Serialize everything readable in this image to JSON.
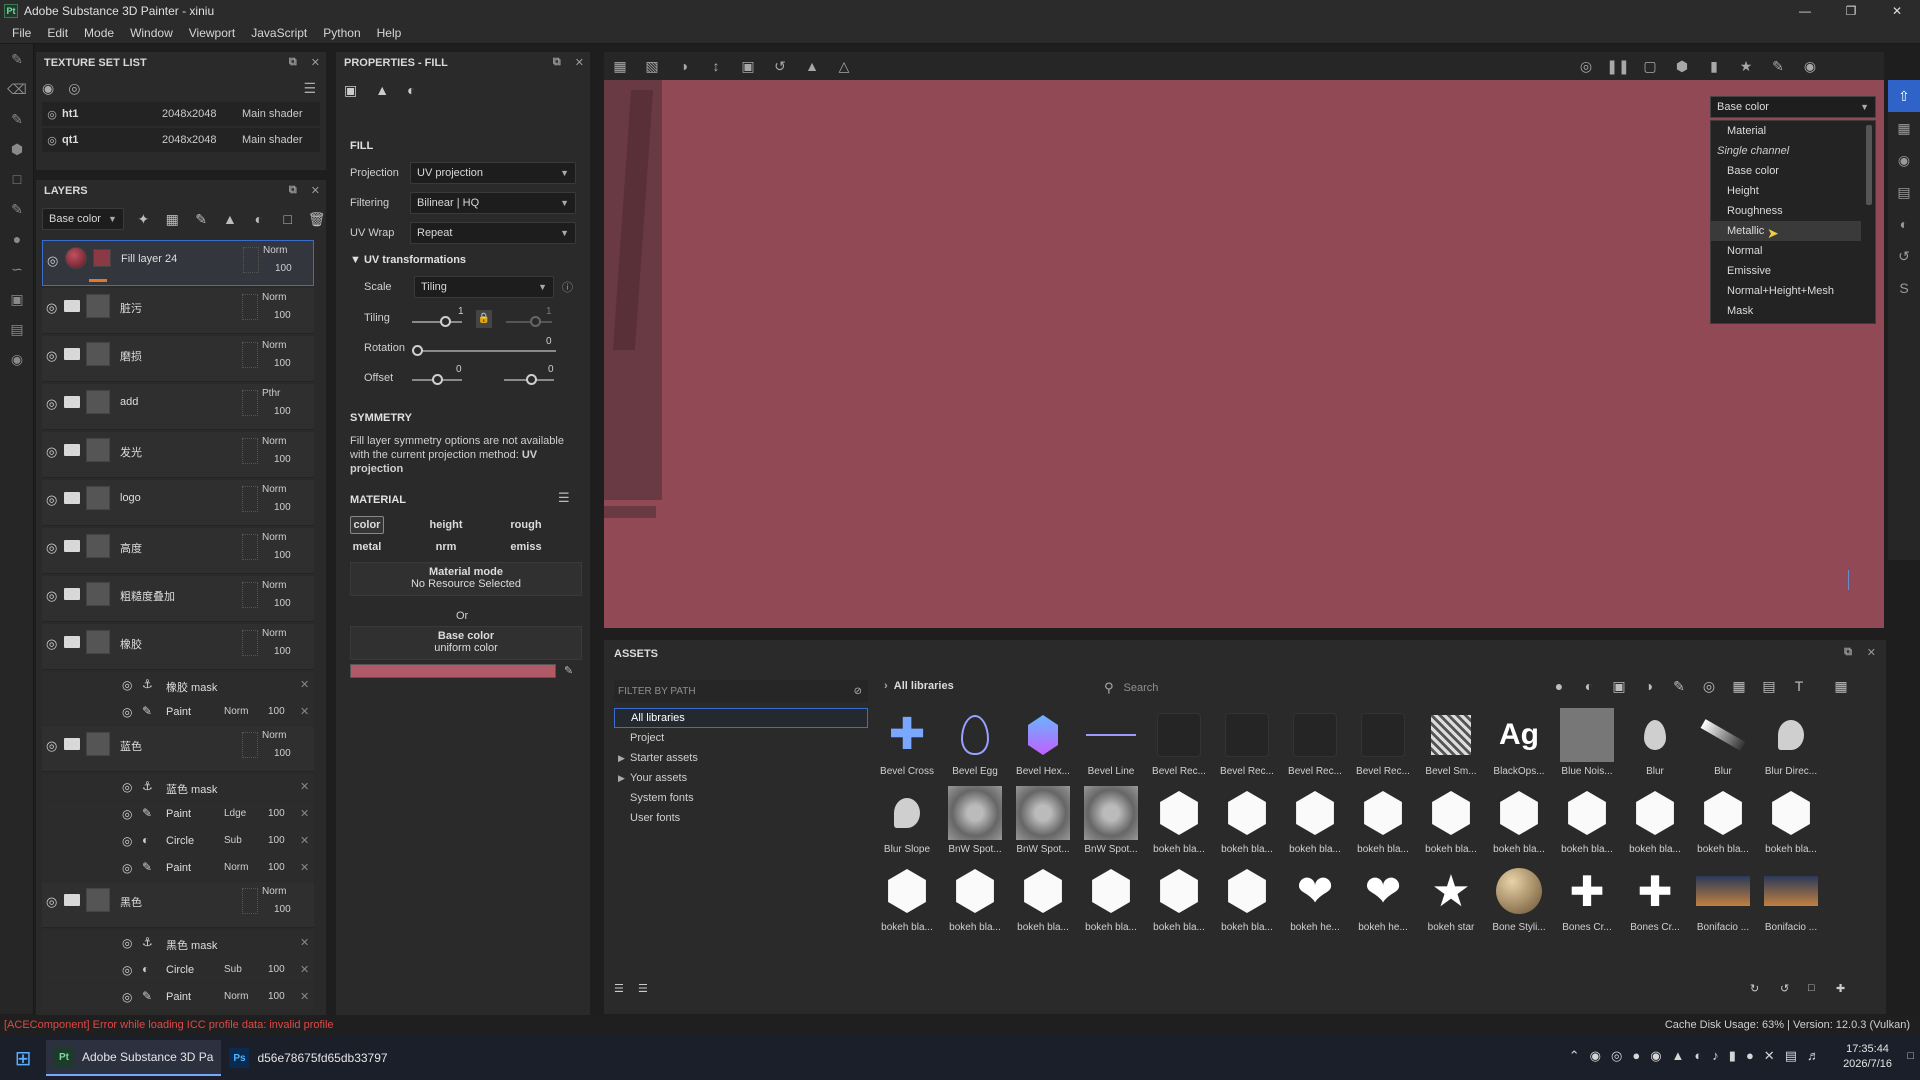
{
  "window": {
    "title": "Adobe Substance 3D Painter - xiniu",
    "logo": "Pt"
  },
  "menu": [
    "File",
    "Edit",
    "Mode",
    "Window",
    "Viewport",
    "JavaScript",
    "Python",
    "Help"
  ],
  "texture_set_list": {
    "title": "TEXTURE SET LIST",
    "rows": [
      {
        "name": "ht1",
        "res": "2048x2048",
        "shader": "Main shader"
      },
      {
        "name": "qt1",
        "res": "2048x2048",
        "shader": "Main shader"
      }
    ]
  },
  "layers": {
    "title": "LAYERS",
    "channel": "Base color",
    "items": [
      {
        "name": "Fill layer 24",
        "blend": "Norm",
        "opacity": "100",
        "type": "fill"
      },
      {
        "name": "脏污",
        "blend": "Norm",
        "opacity": "100",
        "type": "folder"
      },
      {
        "name": "磨损",
        "blend": "Norm",
        "opacity": "100",
        "type": "folder"
      },
      {
        "name": "add",
        "blend": "Pthr",
        "opacity": "100",
        "type": "folder"
      },
      {
        "name": "发光",
        "blend": "Norm",
        "opacity": "100",
        "type": "folder"
      },
      {
        "name": "logo",
        "blend": "Norm",
        "opacity": "100",
        "type": "folder"
      },
      {
        "name": "高度",
        "blend": "Norm",
        "opacity": "100",
        "type": "folder"
      },
      {
        "name": "粗糙度叠加",
        "blend": "Norm",
        "opacity": "100",
        "type": "folder"
      },
      {
        "name": "橡胶",
        "blend": "Norm",
        "opacity": "100",
        "type": "folder"
      },
      {
        "name": "蓝色",
        "blend": "Norm",
        "opacity": "100",
        "type": "folder"
      },
      {
        "name": "黑色",
        "blend": "Norm",
        "opacity": "100",
        "type": "folder"
      }
    ],
    "sub": [
      {
        "name": "橡胶 mask",
        "blend": "",
        "opacity": ""
      },
      {
        "name": "Paint",
        "blend": "Norm",
        "opacity": "100"
      },
      {
        "name": "蓝色 mask",
        "blend": "",
        "opacity": ""
      },
      {
        "name": "Paint",
        "blend": "Ldge",
        "opacity": "100"
      },
      {
        "name": "Circle",
        "blend": "Sub",
        "opacity": "100"
      },
      {
        "name": "Paint",
        "blend": "Norm",
        "opacity": "100"
      },
      {
        "name": "黑色 mask",
        "blend": "",
        "opacity": ""
      },
      {
        "name": "Circle",
        "blend": "Sub",
        "opacity": "100"
      },
      {
        "name": "Paint",
        "blend": "Norm",
        "opacity": "100"
      }
    ]
  },
  "properties": {
    "title": "PROPERTIES - FILL",
    "fill": "FILL",
    "projection_label": "Projection",
    "projection": "UV projection",
    "filtering_label": "Filtering",
    "filtering": "Bilinear | HQ",
    "uvwrap_label": "UV Wrap",
    "uvwrap": "Repeat",
    "uv_trans": "UV transformations",
    "scale_label": "Scale",
    "scale": "Tiling",
    "tiling_label": "Tiling",
    "tiling_val": "1",
    "tiling_val2": "1",
    "rotation_label": "Rotation",
    "rotation_val": "0",
    "offset_label": "Offset",
    "offset_val1": "0",
    "offset_val2": "0",
    "symmetry": "SYMMETRY",
    "sym_text": "Fill layer symmetry options are not available with the current projection method:",
    "sym_bold": "UV projection",
    "material": "MATERIAL",
    "chips": [
      "color",
      "height",
      "rough",
      "metal",
      "nrm",
      "emiss"
    ],
    "mat_mode": "Material mode",
    "no_res": "No Resource Selected",
    "or": "Or",
    "base_color": "Base color",
    "uniform": "uniform color",
    "swatch": "#b05a67"
  },
  "viewport": {
    "color": "#914956",
    "channel": "Base color",
    "menu": [
      {
        "label": "Material",
        "type": "item"
      },
      {
        "label": "Single channel",
        "type": "header"
      },
      {
        "label": "Base color",
        "type": "item"
      },
      {
        "label": "Height",
        "type": "item"
      },
      {
        "label": "Roughness",
        "type": "item"
      },
      {
        "label": "Metallic",
        "type": "item",
        "hl": true
      },
      {
        "label": "Normal",
        "type": "item"
      },
      {
        "label": "Emissive",
        "type": "item"
      },
      {
        "label": "Normal+Height+Mesh",
        "type": "item"
      },
      {
        "label": "Mask",
        "type": "item"
      }
    ]
  },
  "assets": {
    "title": "ASSETS",
    "filter": "FILTER BY PATH",
    "all": "All libraries",
    "search": "Search",
    "tree": [
      "All libraries",
      "Project",
      "Starter assets",
      "Your assets",
      "System fonts",
      "User fonts"
    ],
    "row1": [
      "Bevel Cross",
      "Bevel Egg",
      "Bevel Hex...",
      "Bevel Line",
      "Bevel Rec...",
      "Bevel Rec...",
      "Bevel Rec...",
      "Bevel Rec...",
      "Bevel Sm...",
      "BlackOps...",
      "Blue Nois...",
      "Blur",
      "Blur",
      "Blur Direc..."
    ],
    "row2": [
      "Blur Slope",
      "BnW Spot...",
      "BnW Spot...",
      "BnW Spot...",
      "bokeh bla...",
      "bokeh bla...",
      "bokeh bla...",
      "bokeh bla...",
      "bokeh bla...",
      "bokeh bla...",
      "bokeh bla...",
      "bokeh bla...",
      "bokeh bla...",
      "bokeh bla..."
    ],
    "row3": [
      "bokeh bla...",
      "bokeh bla...",
      "bokeh bla...",
      "bokeh bla...",
      "bokeh bla...",
      "bokeh bla...",
      "bokeh he...",
      "bokeh he...",
      "bokeh star",
      "Bone Styli...",
      "Bones Cr...",
      "Bones Cr...",
      "Bonifacio ...",
      "Bonifacio ..."
    ]
  },
  "status": {
    "error": "[ACEComponent] Error while loading ICC profile data: invalid profile",
    "right": "Cache Disk Usage:    63% | Version: 12.0.3 (Vulkan)"
  },
  "taskbar": {
    "app1": "Adobe Substance 3D Pa",
    "app2": "d56e78675fd65db33797",
    "time": "17:35:44",
    "date": "2026/7/16"
  }
}
